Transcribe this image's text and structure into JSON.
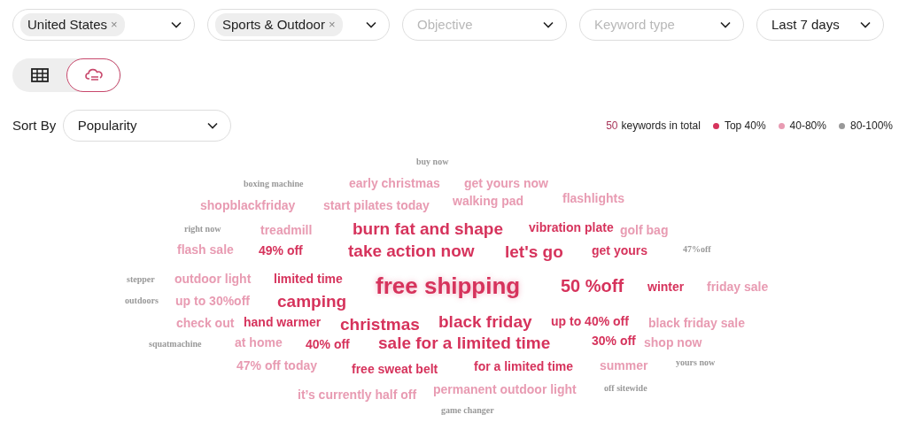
{
  "filters": [
    {
      "kind": "chip",
      "chip": "United States",
      "remove": "×"
    },
    {
      "kind": "chip",
      "chip": "Sports & Outdoor",
      "remove": "×"
    },
    {
      "kind": "placeholder",
      "placeholder": "Objective"
    },
    {
      "kind": "placeholder",
      "placeholder": "Keyword type"
    },
    {
      "kind": "value",
      "value": "Last 7 days"
    }
  ],
  "view_toggle": [
    {
      "kind": "table",
      "selected": false
    },
    {
      "kind": "cloud",
      "selected": true
    }
  ],
  "sort": {
    "label": "Sort By",
    "value": "Popularity"
  },
  "legend": {
    "count": "50",
    "count_label": "keywords in total",
    "tiers": [
      {
        "label": "Top 40%",
        "color": "#d6335c"
      },
      {
        "label": "40-80%",
        "color": "#e89bb2"
      },
      {
        "label": "80-100%",
        "color": "#999999"
      }
    ]
  },
  "keywords": [
    {
      "text": "buy now",
      "color": "#999999"
    },
    {
      "text": "boxing machine",
      "color": "#999999"
    },
    {
      "text": "early christmas",
      "color": "#e89bb2"
    },
    {
      "text": "get yours now",
      "color": "#e89bb2"
    },
    {
      "text": "shopblackfriday",
      "color": "#e89bb2"
    },
    {
      "text": "start pilates today",
      "color": "#e89bb2"
    },
    {
      "text": "walking pad",
      "color": "#e89bb2"
    },
    {
      "text": "flashlights",
      "color": "#e89bb2"
    },
    {
      "text": "right now",
      "color": "#999999"
    },
    {
      "text": "treadmill",
      "color": "#e89bb2"
    },
    {
      "text": "burn fat and shape",
      "color": "#d6335c"
    },
    {
      "text": "vibration plate",
      "color": "#d6335c"
    },
    {
      "text": "golf bag",
      "color": "#e89bb2"
    },
    {
      "text": "flash sale",
      "color": "#e89bb2"
    },
    {
      "text": "49% off",
      "color": "#d6335c"
    },
    {
      "text": "take action now",
      "color": "#d6335c"
    },
    {
      "text": "let's go",
      "color": "#d6335c"
    },
    {
      "text": "get yours",
      "color": "#d6335c"
    },
    {
      "text": "47%off",
      "color": "#999999"
    },
    {
      "text": "stepper",
      "color": "#999999"
    },
    {
      "text": "outdoor light",
      "color": "#e89bb2"
    },
    {
      "text": "limited time",
      "color": "#d6335c"
    },
    {
      "text": "free shipping",
      "color": "#d6335c"
    },
    {
      "text": "50 %off",
      "color": "#d6335c"
    },
    {
      "text": "winter",
      "color": "#d6335c"
    },
    {
      "text": "friday sale",
      "color": "#e89bb2"
    },
    {
      "text": "outdoors",
      "color": "#999999"
    },
    {
      "text": "up to 30%off",
      "color": "#e89bb2"
    },
    {
      "text": "camping",
      "color": "#d6335c"
    },
    {
      "text": "check out",
      "color": "#e89bb2"
    },
    {
      "text": "hand warmer",
      "color": "#d6335c"
    },
    {
      "text": "christmas",
      "color": "#d6335c"
    },
    {
      "text": "black friday",
      "color": "#d6335c"
    },
    {
      "text": "up to 40% off",
      "color": "#d6335c"
    },
    {
      "text": "black friday sale",
      "color": "#e89bb2"
    },
    {
      "text": "squatmachine",
      "color": "#999999"
    },
    {
      "text": "at home",
      "color": "#e89bb2"
    },
    {
      "text": "40% off",
      "color": "#d6335c"
    },
    {
      "text": "sale for a limited time",
      "color": "#d6335c"
    },
    {
      "text": "30% off",
      "color": "#d6335c"
    },
    {
      "text": "shop now",
      "color": "#e89bb2"
    },
    {
      "text": "47% off today",
      "color": "#e89bb2"
    },
    {
      "text": "free sweat belt",
      "color": "#d6335c"
    },
    {
      "text": "for a limited time",
      "color": "#d6335c"
    },
    {
      "text": "summer",
      "color": "#e89bb2"
    },
    {
      "text": "yours now",
      "color": "#999999"
    },
    {
      "text": "it’s currently half off",
      "color": "#e89bb2"
    },
    {
      "text": "permanent outdoor light",
      "color": "#e89bb2"
    },
    {
      "text": "off sitewide",
      "color": "#999999"
    },
    {
      "text": "game changer",
      "color": "#999999"
    }
  ]
}
